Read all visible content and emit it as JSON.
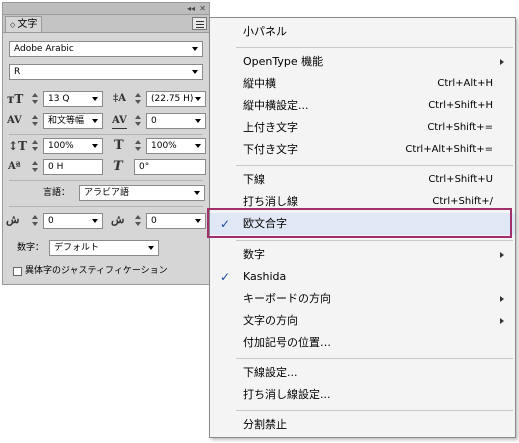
{
  "panel": {
    "tab_label": "文字",
    "font_family": "Adobe Arabic",
    "font_style": "R",
    "font_size": "13 Q",
    "leading": "(22.75 H)",
    "kerning": "和文等幅",
    "tracking": "0",
    "vertical_scale": "100%",
    "horizontal_scale": "100%",
    "baseline_shift": "0 H",
    "skew": "0°",
    "language_label": "言語：",
    "language_value": "アラビア語",
    "kashida_left": "0",
    "kashida_right": "0",
    "digits_label": "数字：",
    "digits_value": "デフォルト",
    "justification_label": "異体字のジャスティフィケーション",
    "justification_checked": false
  },
  "menu": {
    "items": [
      {
        "label": "小パネル",
        "shortcut": "",
        "submenu": false,
        "checked": false
      },
      {
        "label": "OpenType 機能",
        "shortcut": "",
        "submenu": true,
        "checked": false
      },
      {
        "label": "縦中横",
        "shortcut": "Ctrl+Alt+H",
        "submenu": false,
        "checked": false
      },
      {
        "label": "縦中横設定...",
        "shortcut": "Ctrl+Shift+H",
        "submenu": false,
        "checked": false
      },
      {
        "label": "上付き文字",
        "shortcut": "Ctrl+Shift+=",
        "submenu": false,
        "checked": false
      },
      {
        "label": "下付き文字",
        "shortcut": "Ctrl+Alt+Shift+=",
        "submenu": false,
        "checked": false
      },
      {
        "label": "下線",
        "shortcut": "Ctrl+Shift+U",
        "submenu": false,
        "checked": false
      },
      {
        "label": "打ち消し線",
        "shortcut": "Ctrl+Shift+/",
        "submenu": false,
        "checked": false
      },
      {
        "label": "欧文合字",
        "shortcut": "",
        "submenu": false,
        "checked": true
      },
      {
        "label": "数字",
        "shortcut": "",
        "submenu": true,
        "checked": false
      },
      {
        "label": "Kashida",
        "shortcut": "",
        "submenu": false,
        "checked": true
      },
      {
        "label": "キーボードの方向",
        "shortcut": "",
        "submenu": true,
        "checked": false
      },
      {
        "label": "文字の方向",
        "shortcut": "",
        "submenu": true,
        "checked": false
      },
      {
        "label": "付加記号の位置…",
        "shortcut": "",
        "submenu": false,
        "checked": false
      },
      {
        "label": "下線設定...",
        "shortcut": "",
        "submenu": false,
        "checked": false
      },
      {
        "label": "打ち消し線設定...",
        "shortcut": "",
        "submenu": false,
        "checked": false
      },
      {
        "label": "分割禁止",
        "shortcut": "",
        "submenu": false,
        "checked": false
      }
    ],
    "check_glyph": "✓",
    "highlight_color": "#a0306c"
  }
}
